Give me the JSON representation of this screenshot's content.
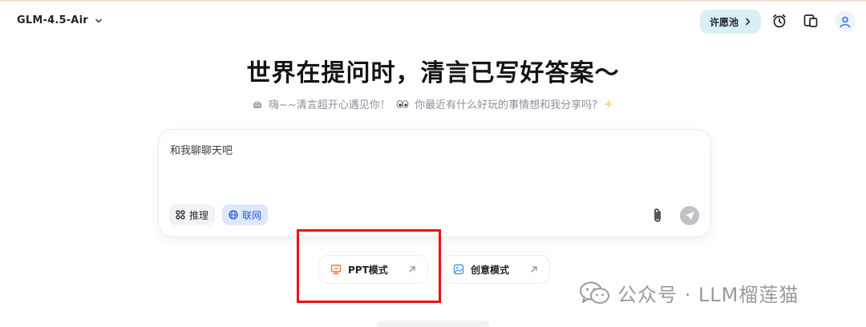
{
  "header": {
    "model_label": "GLM-4.5-Air",
    "wish_button_label": "许愿池",
    "icons": [
      "chevron-down-icon",
      "chevron-right-icon",
      "alarm-clock-icon",
      "devices-icon",
      "user-icon"
    ]
  },
  "hero": {
    "title": "世界在提问时，清言已写好答案～",
    "subtitle_part1": "嗨~~清言超开心遇见你！",
    "subtitle_part2": "你最近有什么好玩的事情想和我分享吗?",
    "emojis": [
      "robot-emoji",
      "eyes-emoji",
      "sparkle-emoji"
    ]
  },
  "chat": {
    "placeholder": "和我聊聊天吧",
    "value": "",
    "chips": {
      "reason_label": "推理",
      "web_label": "联网"
    }
  },
  "modes": {
    "ppt_label": "PPT模式",
    "creative_label": "创意模式"
  },
  "watermark": {
    "text": "公众号 · LLM榴莲猫"
  },
  "colors": {
    "accent_blue": "#2f5bd6",
    "wish_bg": "#d7f0f5",
    "annotation_red": "#f20f0f"
  }
}
